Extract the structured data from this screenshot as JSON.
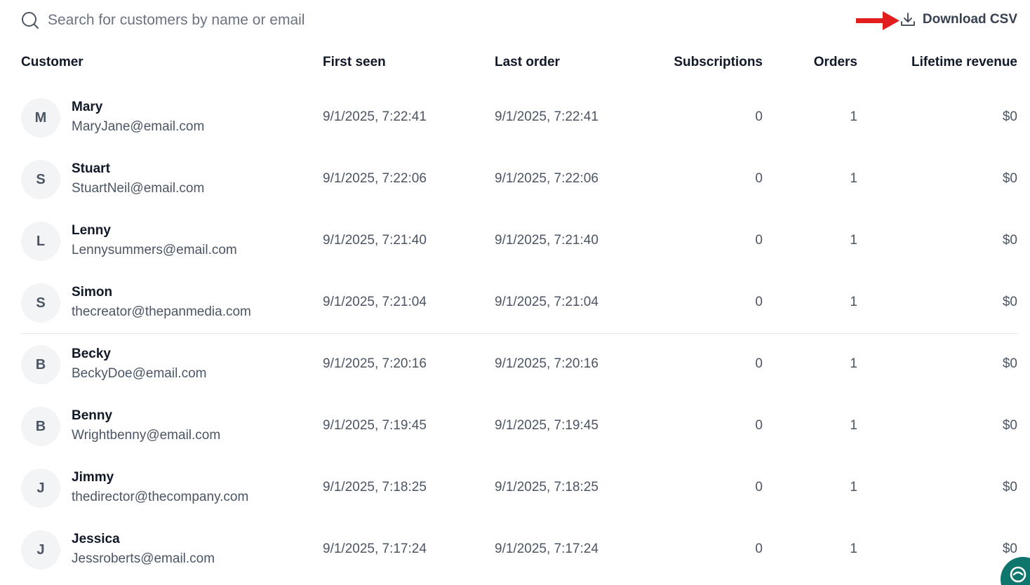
{
  "search": {
    "placeholder": "Search for customers by name or email",
    "icon": "search-icon"
  },
  "toolbar": {
    "download_label": "Download CSV",
    "download_icon": "download-icon",
    "arrow_color": "#e11d1d"
  },
  "table": {
    "columns": {
      "customer": "Customer",
      "first_seen": "First seen",
      "last_order": "Last order",
      "subscriptions": "Subscriptions",
      "orders": "Orders",
      "lifetime_revenue": "Lifetime revenue"
    },
    "rows": [
      {
        "initial": "M",
        "name": "Mary",
        "email": "MaryJane@email.com",
        "first_seen": "9/1/2025, 7:22:41",
        "last_order": "9/1/2025, 7:22:41",
        "subscriptions": "0",
        "orders": "1",
        "revenue": "$0"
      },
      {
        "initial": "S",
        "name": "Stuart",
        "email": "StuartNeil@email.com",
        "first_seen": "9/1/2025, 7:22:06",
        "last_order": "9/1/2025, 7:22:06",
        "subscriptions": "0",
        "orders": "1",
        "revenue": "$0"
      },
      {
        "initial": "L",
        "name": "Lenny",
        "email": "Lennysummers@email.com",
        "first_seen": "9/1/2025, 7:21:40",
        "last_order": "9/1/2025, 7:21:40",
        "subscriptions": "0",
        "orders": "1",
        "revenue": "$0"
      },
      {
        "initial": "S",
        "name": "Simon",
        "email": "thecreator@thepanmedia.com",
        "first_seen": "9/1/2025, 7:21:04",
        "last_order": "9/1/2025, 7:21:04",
        "subscriptions": "0",
        "orders": "1",
        "revenue": "$0"
      },
      {
        "initial": "B",
        "name": "Becky",
        "email": "BeckyDoe@email.com",
        "first_seen": "9/1/2025, 7:20:16",
        "last_order": "9/1/2025, 7:20:16",
        "subscriptions": "0",
        "orders": "1",
        "revenue": "$0"
      },
      {
        "initial": "B",
        "name": "Benny",
        "email": "Wrightbenny@email.com",
        "first_seen": "9/1/2025, 7:19:45",
        "last_order": "9/1/2025, 7:19:45",
        "subscriptions": "0",
        "orders": "1",
        "revenue": "$0"
      },
      {
        "initial": "J",
        "name": "Jimmy",
        "email": "thedirector@thecompany.com",
        "first_seen": "9/1/2025, 7:18:25",
        "last_order": "9/1/2025, 7:18:25",
        "subscriptions": "0",
        "orders": "1",
        "revenue": "$0"
      },
      {
        "initial": "J",
        "name": "Jessica",
        "email": "Jessroberts@email.com",
        "first_seen": "9/1/2025, 7:17:24",
        "last_order": "9/1/2025, 7:17:24",
        "subscriptions": "0",
        "orders": "1",
        "revenue": "$0"
      }
    ]
  },
  "chat": {
    "icon": "chat-support-icon",
    "color": "#0f766e"
  }
}
